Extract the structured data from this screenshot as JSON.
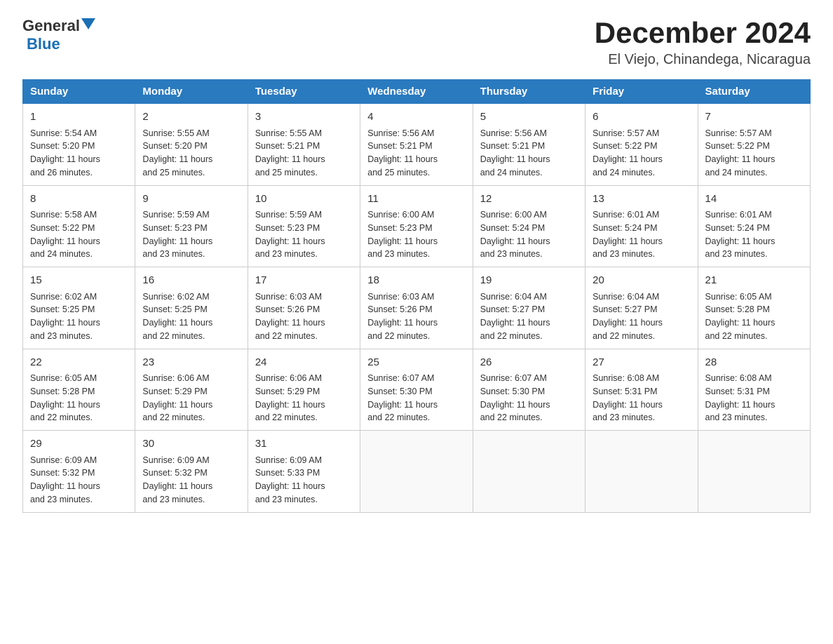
{
  "header": {
    "logo_general": "General",
    "logo_blue": "Blue",
    "month_title": "December 2024",
    "location": "El Viejo, Chinandega, Nicaragua"
  },
  "days_of_week": [
    "Sunday",
    "Monday",
    "Tuesday",
    "Wednesday",
    "Thursday",
    "Friday",
    "Saturday"
  ],
  "weeks": [
    [
      {
        "day": "1",
        "sunrise": "5:54 AM",
        "sunset": "5:20 PM",
        "daylight": "11 hours and 26 minutes."
      },
      {
        "day": "2",
        "sunrise": "5:55 AM",
        "sunset": "5:20 PM",
        "daylight": "11 hours and 25 minutes."
      },
      {
        "day": "3",
        "sunrise": "5:55 AM",
        "sunset": "5:21 PM",
        "daylight": "11 hours and 25 minutes."
      },
      {
        "day": "4",
        "sunrise": "5:56 AM",
        "sunset": "5:21 PM",
        "daylight": "11 hours and 25 minutes."
      },
      {
        "day": "5",
        "sunrise": "5:56 AM",
        "sunset": "5:21 PM",
        "daylight": "11 hours and 24 minutes."
      },
      {
        "day": "6",
        "sunrise": "5:57 AM",
        "sunset": "5:22 PM",
        "daylight": "11 hours and 24 minutes."
      },
      {
        "day": "7",
        "sunrise": "5:57 AM",
        "sunset": "5:22 PM",
        "daylight": "11 hours and 24 minutes."
      }
    ],
    [
      {
        "day": "8",
        "sunrise": "5:58 AM",
        "sunset": "5:22 PM",
        "daylight": "11 hours and 24 minutes."
      },
      {
        "day": "9",
        "sunrise": "5:59 AM",
        "sunset": "5:23 PM",
        "daylight": "11 hours and 23 minutes."
      },
      {
        "day": "10",
        "sunrise": "5:59 AM",
        "sunset": "5:23 PM",
        "daylight": "11 hours and 23 minutes."
      },
      {
        "day": "11",
        "sunrise": "6:00 AM",
        "sunset": "5:23 PM",
        "daylight": "11 hours and 23 minutes."
      },
      {
        "day": "12",
        "sunrise": "6:00 AM",
        "sunset": "5:24 PM",
        "daylight": "11 hours and 23 minutes."
      },
      {
        "day": "13",
        "sunrise": "6:01 AM",
        "sunset": "5:24 PM",
        "daylight": "11 hours and 23 minutes."
      },
      {
        "day": "14",
        "sunrise": "6:01 AM",
        "sunset": "5:24 PM",
        "daylight": "11 hours and 23 minutes."
      }
    ],
    [
      {
        "day": "15",
        "sunrise": "6:02 AM",
        "sunset": "5:25 PM",
        "daylight": "11 hours and 23 minutes."
      },
      {
        "day": "16",
        "sunrise": "6:02 AM",
        "sunset": "5:25 PM",
        "daylight": "11 hours and 22 minutes."
      },
      {
        "day": "17",
        "sunrise": "6:03 AM",
        "sunset": "5:26 PM",
        "daylight": "11 hours and 22 minutes."
      },
      {
        "day": "18",
        "sunrise": "6:03 AM",
        "sunset": "5:26 PM",
        "daylight": "11 hours and 22 minutes."
      },
      {
        "day": "19",
        "sunrise": "6:04 AM",
        "sunset": "5:27 PM",
        "daylight": "11 hours and 22 minutes."
      },
      {
        "day": "20",
        "sunrise": "6:04 AM",
        "sunset": "5:27 PM",
        "daylight": "11 hours and 22 minutes."
      },
      {
        "day": "21",
        "sunrise": "6:05 AM",
        "sunset": "5:28 PM",
        "daylight": "11 hours and 22 minutes."
      }
    ],
    [
      {
        "day": "22",
        "sunrise": "6:05 AM",
        "sunset": "5:28 PM",
        "daylight": "11 hours and 22 minutes."
      },
      {
        "day": "23",
        "sunrise": "6:06 AM",
        "sunset": "5:29 PM",
        "daylight": "11 hours and 22 minutes."
      },
      {
        "day": "24",
        "sunrise": "6:06 AM",
        "sunset": "5:29 PM",
        "daylight": "11 hours and 22 minutes."
      },
      {
        "day": "25",
        "sunrise": "6:07 AM",
        "sunset": "5:30 PM",
        "daylight": "11 hours and 22 minutes."
      },
      {
        "day": "26",
        "sunrise": "6:07 AM",
        "sunset": "5:30 PM",
        "daylight": "11 hours and 22 minutes."
      },
      {
        "day": "27",
        "sunrise": "6:08 AM",
        "sunset": "5:31 PM",
        "daylight": "11 hours and 23 minutes."
      },
      {
        "day": "28",
        "sunrise": "6:08 AM",
        "sunset": "5:31 PM",
        "daylight": "11 hours and 23 minutes."
      }
    ],
    [
      {
        "day": "29",
        "sunrise": "6:09 AM",
        "sunset": "5:32 PM",
        "daylight": "11 hours and 23 minutes."
      },
      {
        "day": "30",
        "sunrise": "6:09 AM",
        "sunset": "5:32 PM",
        "daylight": "11 hours and 23 minutes."
      },
      {
        "day": "31",
        "sunrise": "6:09 AM",
        "sunset": "5:33 PM",
        "daylight": "11 hours and 23 minutes."
      },
      null,
      null,
      null,
      null
    ]
  ],
  "labels": {
    "sunrise": "Sunrise:",
    "sunset": "Sunset:",
    "daylight": "Daylight:"
  }
}
